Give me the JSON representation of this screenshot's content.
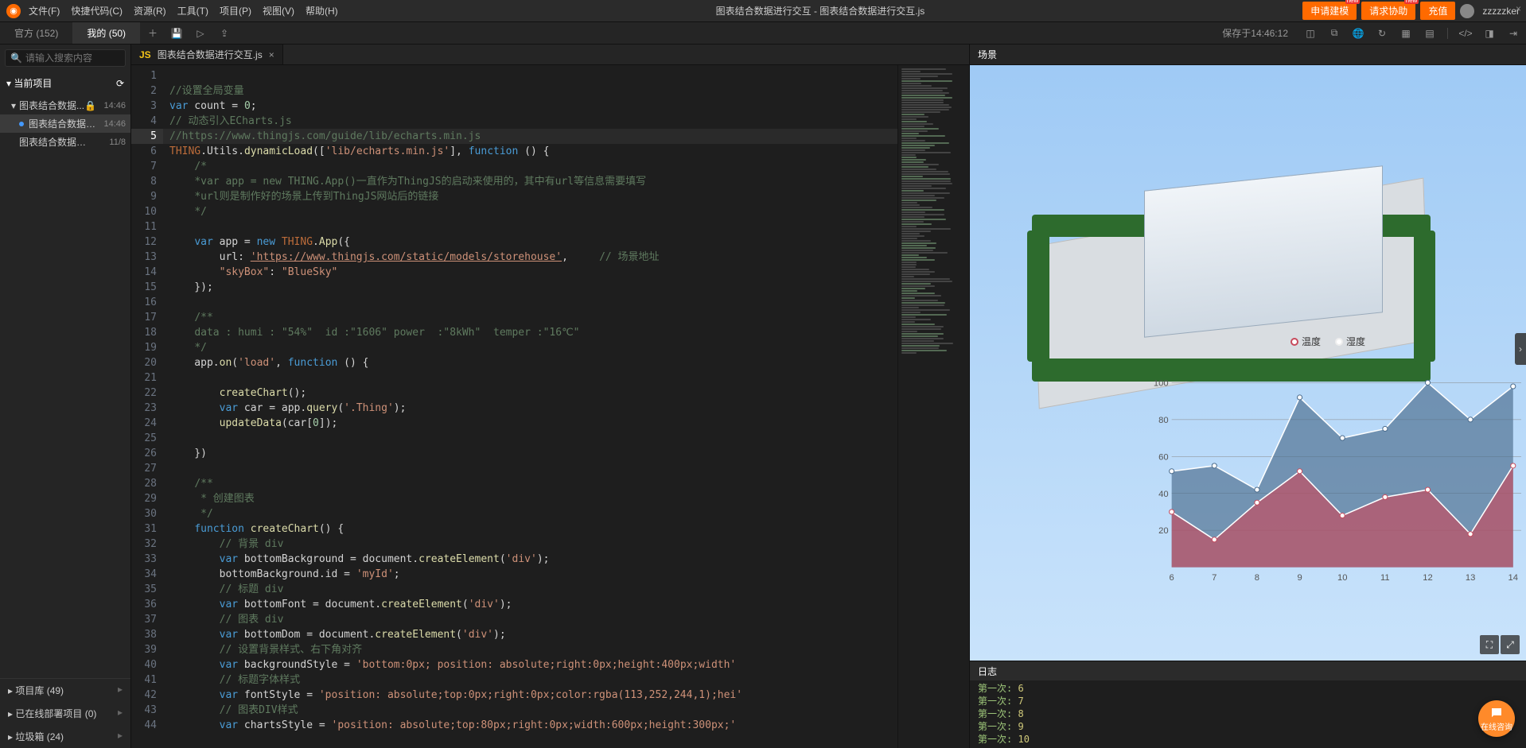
{
  "menus": [
    "文件(F)",
    "快捷代码(C)",
    "资源(R)",
    "工具(T)",
    "项目(P)",
    "视图(V)",
    "帮助(H)"
  ],
  "title": "图表结合数据进行交互 - 图表结合数据进行交互.js",
  "actions": {
    "apply": "申请建模",
    "help": "请求协助",
    "recharge": "充值"
  },
  "badge": "new",
  "username": "zzzzzker",
  "sidetabs": {
    "official": "官方 (152)",
    "mine": "我的 (50)"
  },
  "search_placeholder": "请输入搜索内容",
  "proj_header": "当前项目",
  "tree": [
    {
      "name": "图表结合数据...",
      "lock": true,
      "time": "14:46"
    },
    {
      "name": "图表结合数据进行...",
      "dot": true,
      "time": "14:46",
      "sel": true
    },
    {
      "name": "图表结合数据进行...",
      "time": "11/8"
    }
  ],
  "side_bottom": [
    {
      "label": "项目库 (49)"
    },
    {
      "label": "已在线部署项目 (0)"
    },
    {
      "label": "垃圾箱 (24)"
    }
  ],
  "save_label": "保存于14:46:12",
  "file_tab": "图表结合数据进行交互.js",
  "scene_label": "场景",
  "log_label": "日志",
  "legend": {
    "temp": "温度",
    "humi": "湿度"
  },
  "chat": "在线咨询",
  "logs": [
    {
      "k": "第一次:",
      "v": "6"
    },
    {
      "k": "第一次:",
      "v": "7"
    },
    {
      "k": "第一次:",
      "v": "8"
    },
    {
      "k": "第一次:",
      "v": "9"
    },
    {
      "k": "第一次:",
      "v": "10"
    }
  ],
  "chart_data": {
    "type": "area",
    "x": [
      6,
      7,
      8,
      9,
      10,
      11,
      12,
      13,
      14
    ],
    "ylim": [
      0,
      110
    ],
    "yticks": [
      20,
      40,
      60,
      80,
      100
    ],
    "series": [
      {
        "name": "温度",
        "color": "#c74a5c",
        "values": [
          30,
          15,
          35,
          52,
          28,
          38,
          42,
          18,
          55
        ]
      },
      {
        "name": "湿度",
        "color": "#4a6b8c",
        "values": [
          52,
          55,
          42,
          92,
          70,
          75,
          100,
          80,
          98
        ]
      }
    ]
  },
  "code": [
    {
      "n": 1,
      "h": ""
    },
    {
      "n": 2,
      "h": "<span class='c-cmt'>//设置全局变量</span>"
    },
    {
      "n": 3,
      "h": "<span class='c-kw'>var</span> count = <span class='c-num'>0</span>;"
    },
    {
      "n": 4,
      "h": "<span class='c-cmt'>// 动态引入ECharts.js</span>"
    },
    {
      "n": 5,
      "h": "<span class='c-cmt'>//https://www.thingjs.com/guide/lib/echarts.min.js</span>",
      "hl": true
    },
    {
      "n": 6,
      "h": "<span class='c-cls'>THING</span>.Utils.<span class='c-fn'>dynamicLoad</span>([<span class='c-str'>'lib/echarts.min.js'</span>], <span class='c-kw'>function</span> () {"
    },
    {
      "n": 7,
      "h": "    <span class='c-cmt'>/*</span>"
    },
    {
      "n": 8,
      "h": "    <span class='c-cmt'>*var app = new THING.App()一直作为ThingJS的启动来使用的，其中有url等信息需要填写</span>"
    },
    {
      "n": 9,
      "h": "    <span class='c-cmt'>*url则是制作好的场景上传到ThingJS网站后的链接</span>"
    },
    {
      "n": 10,
      "h": "    <span class='c-cmt'>*/</span>"
    },
    {
      "n": 11,
      "h": ""
    },
    {
      "n": 12,
      "h": "    <span class='c-kw'>var</span> app = <span class='c-kw'>new</span> <span class='c-cls'>THING</span>.<span class='c-fn'>App</span>({"
    },
    {
      "n": 13,
      "h": "        url: <span class='c-link'>'https://www.thingjs.com/static/models/storehouse'</span>,     <span class='c-cmt'>// 场景地址</span>"
    },
    {
      "n": 14,
      "h": "        <span class='c-str'>\"skyBox\"</span>: <span class='c-str'>\"BlueSky\"</span>"
    },
    {
      "n": 15,
      "h": "    });"
    },
    {
      "n": 16,
      "h": ""
    },
    {
      "n": 17,
      "h": "    <span class='c-cmt'>/**</span>"
    },
    {
      "n": 18,
      "h": "    <span class='c-cmt'>data : humi : \"54%\"  id :\"1606\" power  :\"8kWh\"  temper :\"16℃\"</span>"
    },
    {
      "n": 19,
      "h": "    <span class='c-cmt'>*/</span>"
    },
    {
      "n": 20,
      "h": "    app.<span class='c-fn'>on</span>(<span class='c-str'>'load'</span>, <span class='c-kw'>function</span> () {"
    },
    {
      "n": 21,
      "h": ""
    },
    {
      "n": 22,
      "h": "        <span class='c-fn'>createChart</span>();"
    },
    {
      "n": 23,
      "h": "        <span class='c-kw'>var</span> car = app.<span class='c-fn'>query</span>(<span class='c-str'>'.Thing'</span>);"
    },
    {
      "n": 24,
      "h": "        <span class='c-fn'>updateData</span>(car[<span class='c-num'>0</span>]);"
    },
    {
      "n": 25,
      "h": ""
    },
    {
      "n": 26,
      "h": "    })"
    },
    {
      "n": 27,
      "h": ""
    },
    {
      "n": 28,
      "h": "    <span class='c-cmt'>/**</span>"
    },
    {
      "n": 29,
      "h": "    <span class='c-cmt'> * 创建图表</span>"
    },
    {
      "n": 30,
      "h": "    <span class='c-cmt'> */</span>"
    },
    {
      "n": 31,
      "h": "    <span class='c-kw'>function</span> <span class='c-fn'>createChart</span>() {"
    },
    {
      "n": 32,
      "h": "        <span class='c-cmt'>// 背景 div</span>"
    },
    {
      "n": 33,
      "h": "        <span class='c-kw'>var</span> bottomBackground = document.<span class='c-fn'>createElement</span>(<span class='c-str'>'div'</span>);"
    },
    {
      "n": 34,
      "h": "        bottomBackground.id = <span class='c-str'>'myId'</span>;"
    },
    {
      "n": 35,
      "h": "        <span class='c-cmt'>// 标题 div</span>"
    },
    {
      "n": 36,
      "h": "        <span class='c-kw'>var</span> bottomFont = document.<span class='c-fn'>createElement</span>(<span class='c-str'>'div'</span>);"
    },
    {
      "n": 37,
      "h": "        <span class='c-cmt'>// 图表 div</span>"
    },
    {
      "n": 38,
      "h": "        <span class='c-kw'>var</span> bottomDom = document.<span class='c-fn'>createElement</span>(<span class='c-str'>'div'</span>);"
    },
    {
      "n": 39,
      "h": "        <span class='c-cmt'>// 设置背景样式、右下角对齐</span>"
    },
    {
      "n": 40,
      "h": "        <span class='c-kw'>var</span> backgroundStyle = <span class='c-str'>'bottom:0px; position: absolute;right:0px;height:400px;width'</span>"
    },
    {
      "n": 41,
      "h": "        <span class='c-cmt'>// 标题字体样式</span>"
    },
    {
      "n": 42,
      "h": "        <span class='c-kw'>var</span> fontStyle = <span class='c-str'>'position: absolute;top:0px;right:0px;color:rgba(113,252,244,1);hei'</span>"
    },
    {
      "n": 43,
      "h": "        <span class='c-cmt'>// 图表DIV样式</span>"
    },
    {
      "n": 44,
      "h": "        <span class='c-kw'>var</span> chartsStyle = <span class='c-str'>'position: absolute;top:80px;right:0px;width:600px;height:300px;'</span>"
    }
  ]
}
